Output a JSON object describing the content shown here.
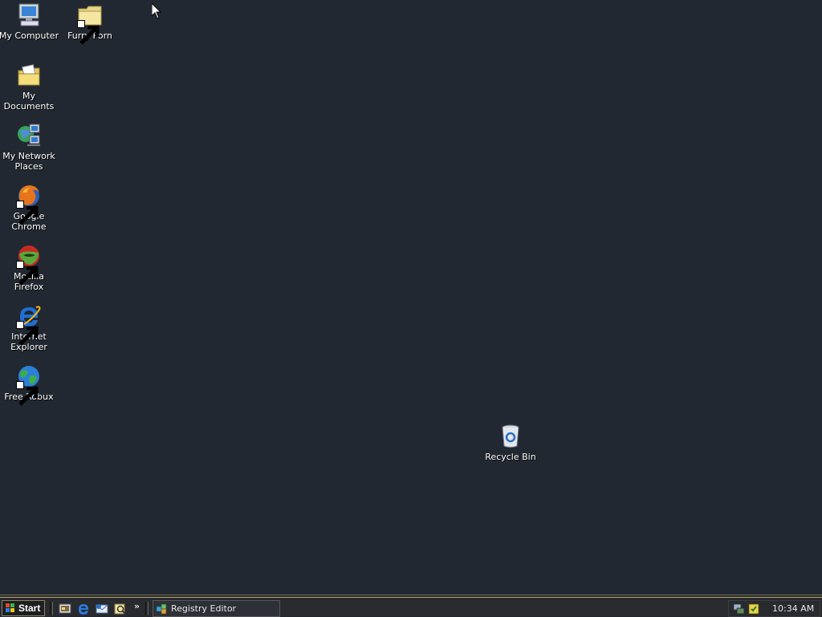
{
  "desktop": {
    "background_color": "#222831",
    "icons": [
      {
        "name": "my-computer-icon",
        "label": "My Computer",
        "icon": "computer-icon",
        "shortcut": false
      },
      {
        "name": "furry-porn-folder",
        "label": "Furry Porn",
        "icon": "folder-icon",
        "shortcut": true
      },
      {
        "name": "my-documents-icon",
        "label": "My Documents",
        "icon": "documents-folder-icon",
        "shortcut": false
      },
      {
        "name": "my-network-places-icon",
        "label": "My Network Places",
        "icon": "network-icon",
        "shortcut": false
      },
      {
        "name": "google-chrome-shortcut",
        "label": "Google Chrome",
        "icon": "firefox-logo-icon",
        "shortcut": true
      },
      {
        "name": "mozilla-firefox-shortcut",
        "label": "Mozilla Firefox",
        "icon": "green-ball-icon",
        "shortcut": true
      },
      {
        "name": "internet-explorer-shortcut",
        "label": "Internet Explorer",
        "icon": "ie-icon",
        "shortcut": true
      },
      {
        "name": "free-robux-shortcut",
        "label": "Free Robux",
        "icon": "globe-icon",
        "shortcut": true
      },
      {
        "name": "recycle-bin-icon",
        "label": "Recycle Bin",
        "icon": "recycle-bin-icon",
        "shortcut": false
      }
    ]
  },
  "taskbar": {
    "start_label": "Start",
    "quick_launch": [
      "show-desktop-icon",
      "ie-icon",
      "outlook-icon",
      "search-icon"
    ],
    "overflow_label": "»",
    "tasks": [
      {
        "label": "Registry Editor",
        "icon": "registry-editor-icon"
      }
    ],
    "tray_icons": [
      "network-tray-icon",
      "security-tray-icon"
    ],
    "clock": "10:34 AM"
  }
}
